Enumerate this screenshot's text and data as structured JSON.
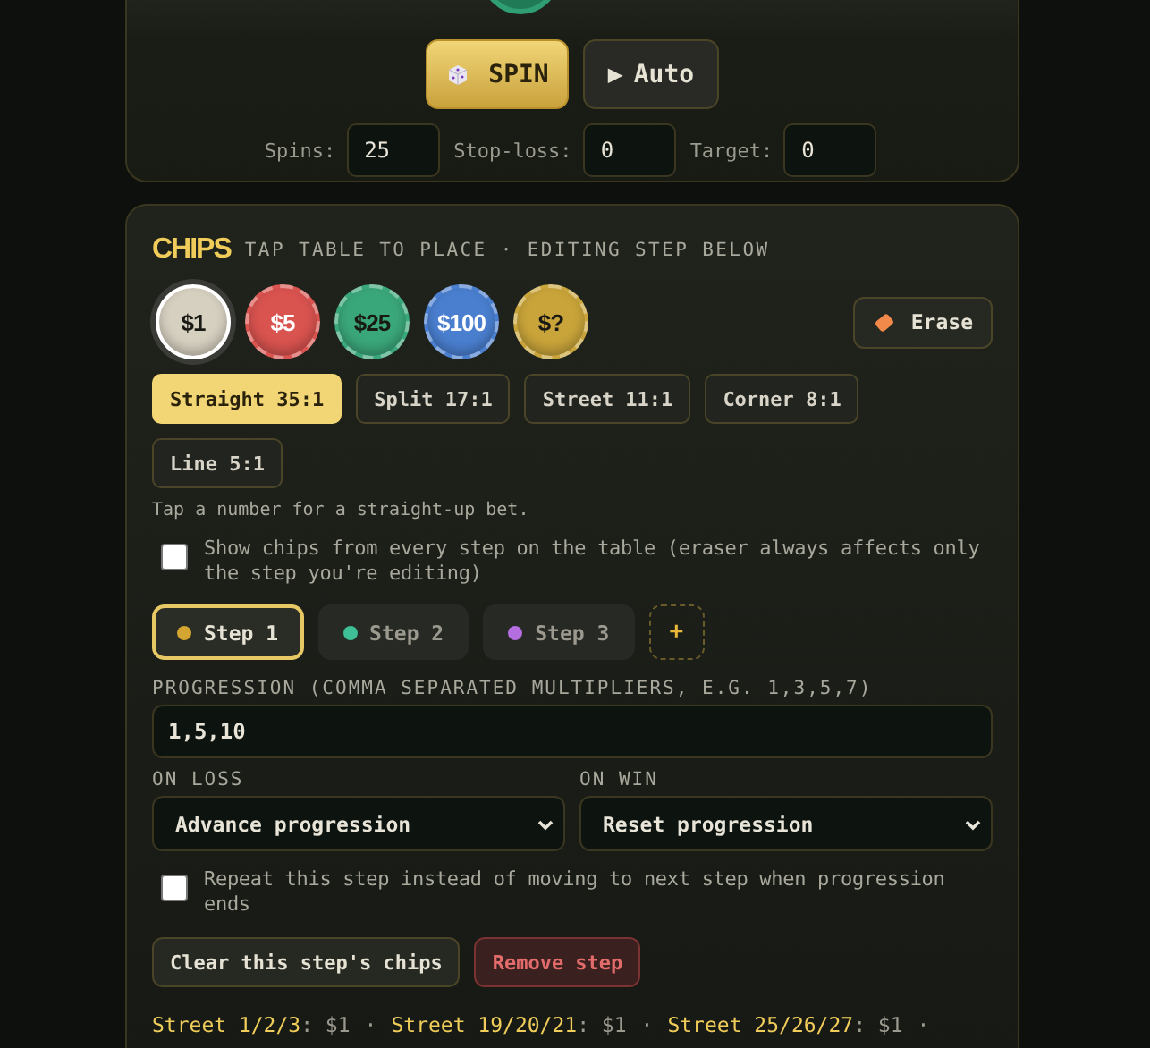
{
  "controls": {
    "spin_button": "SPIN",
    "auto_button": "Auto",
    "auto_icon": "▶",
    "fields": [
      {
        "label": "Spins:",
        "value": "25"
      },
      {
        "label": "Stop-loss:",
        "value": "0"
      },
      {
        "label": "Target:",
        "value": "0"
      }
    ]
  },
  "chips_panel": {
    "title": "CHIPS",
    "subtitle": "TAP TABLE TO PLACE · EDITING STEP BELOW",
    "chips": [
      {
        "label": "$1",
        "color": "#d6d0c0",
        "selected": true
      },
      {
        "label": "$5",
        "color": "#d9534f",
        "selected": false
      },
      {
        "label": "$25",
        "color": "#3aa77a",
        "selected": false
      },
      {
        "label": "$100",
        "color": "#4a7fd0",
        "selected": false
      },
      {
        "label": "$?",
        "color": "#c9a43a",
        "selected": false
      }
    ],
    "erase_button": "Erase",
    "bet_types": [
      {
        "label": "Straight 35:1",
        "selected": true
      },
      {
        "label": "Split 17:1",
        "selected": false
      },
      {
        "label": "Street 11:1",
        "selected": false
      },
      {
        "label": "Corner 8:1",
        "selected": false
      },
      {
        "label": "Line 5:1",
        "selected": false
      }
    ],
    "hint": "Tap a number for a straight-up bet.",
    "show_all_steps": {
      "label": "Show chips from every step on the table (eraser always affects only the step you're editing)",
      "checked": false
    },
    "steps": [
      {
        "label": "Step 1",
        "color": "#d4a531",
        "selected": true
      },
      {
        "label": "Step 2",
        "color": "#3fbf95",
        "selected": false
      },
      {
        "label": "Step 3",
        "color": "#b46ee0",
        "selected": false
      }
    ],
    "add_step_button": "+",
    "progression": {
      "label": "PROGRESSION (COMMA SEPARATED MULTIPLIERS, E.G. 1,3,5,7)",
      "value": "1,5,10"
    },
    "on_loss": {
      "label": "ON LOSS",
      "value": "Advance progression"
    },
    "on_win": {
      "label": "ON WIN",
      "value": "Reset progression"
    },
    "repeat_step": {
      "label": "Repeat this step instead of moving to next step when progression ends",
      "checked": false
    },
    "clear_button": "Clear this step's chips",
    "remove_button": "Remove step",
    "summary": [
      {
        "bet": "Street 1/2/3",
        "colon": ":",
        "amount": "$1",
        "separator": "·"
      },
      {
        "bet": "Street 19/20/21",
        "colon": ":",
        "amount": "$1",
        "separator": "·"
      },
      {
        "bet": "Street 25/26/27",
        "colon": ":",
        "amount": "$1",
        "separator": "·"
      }
    ]
  }
}
